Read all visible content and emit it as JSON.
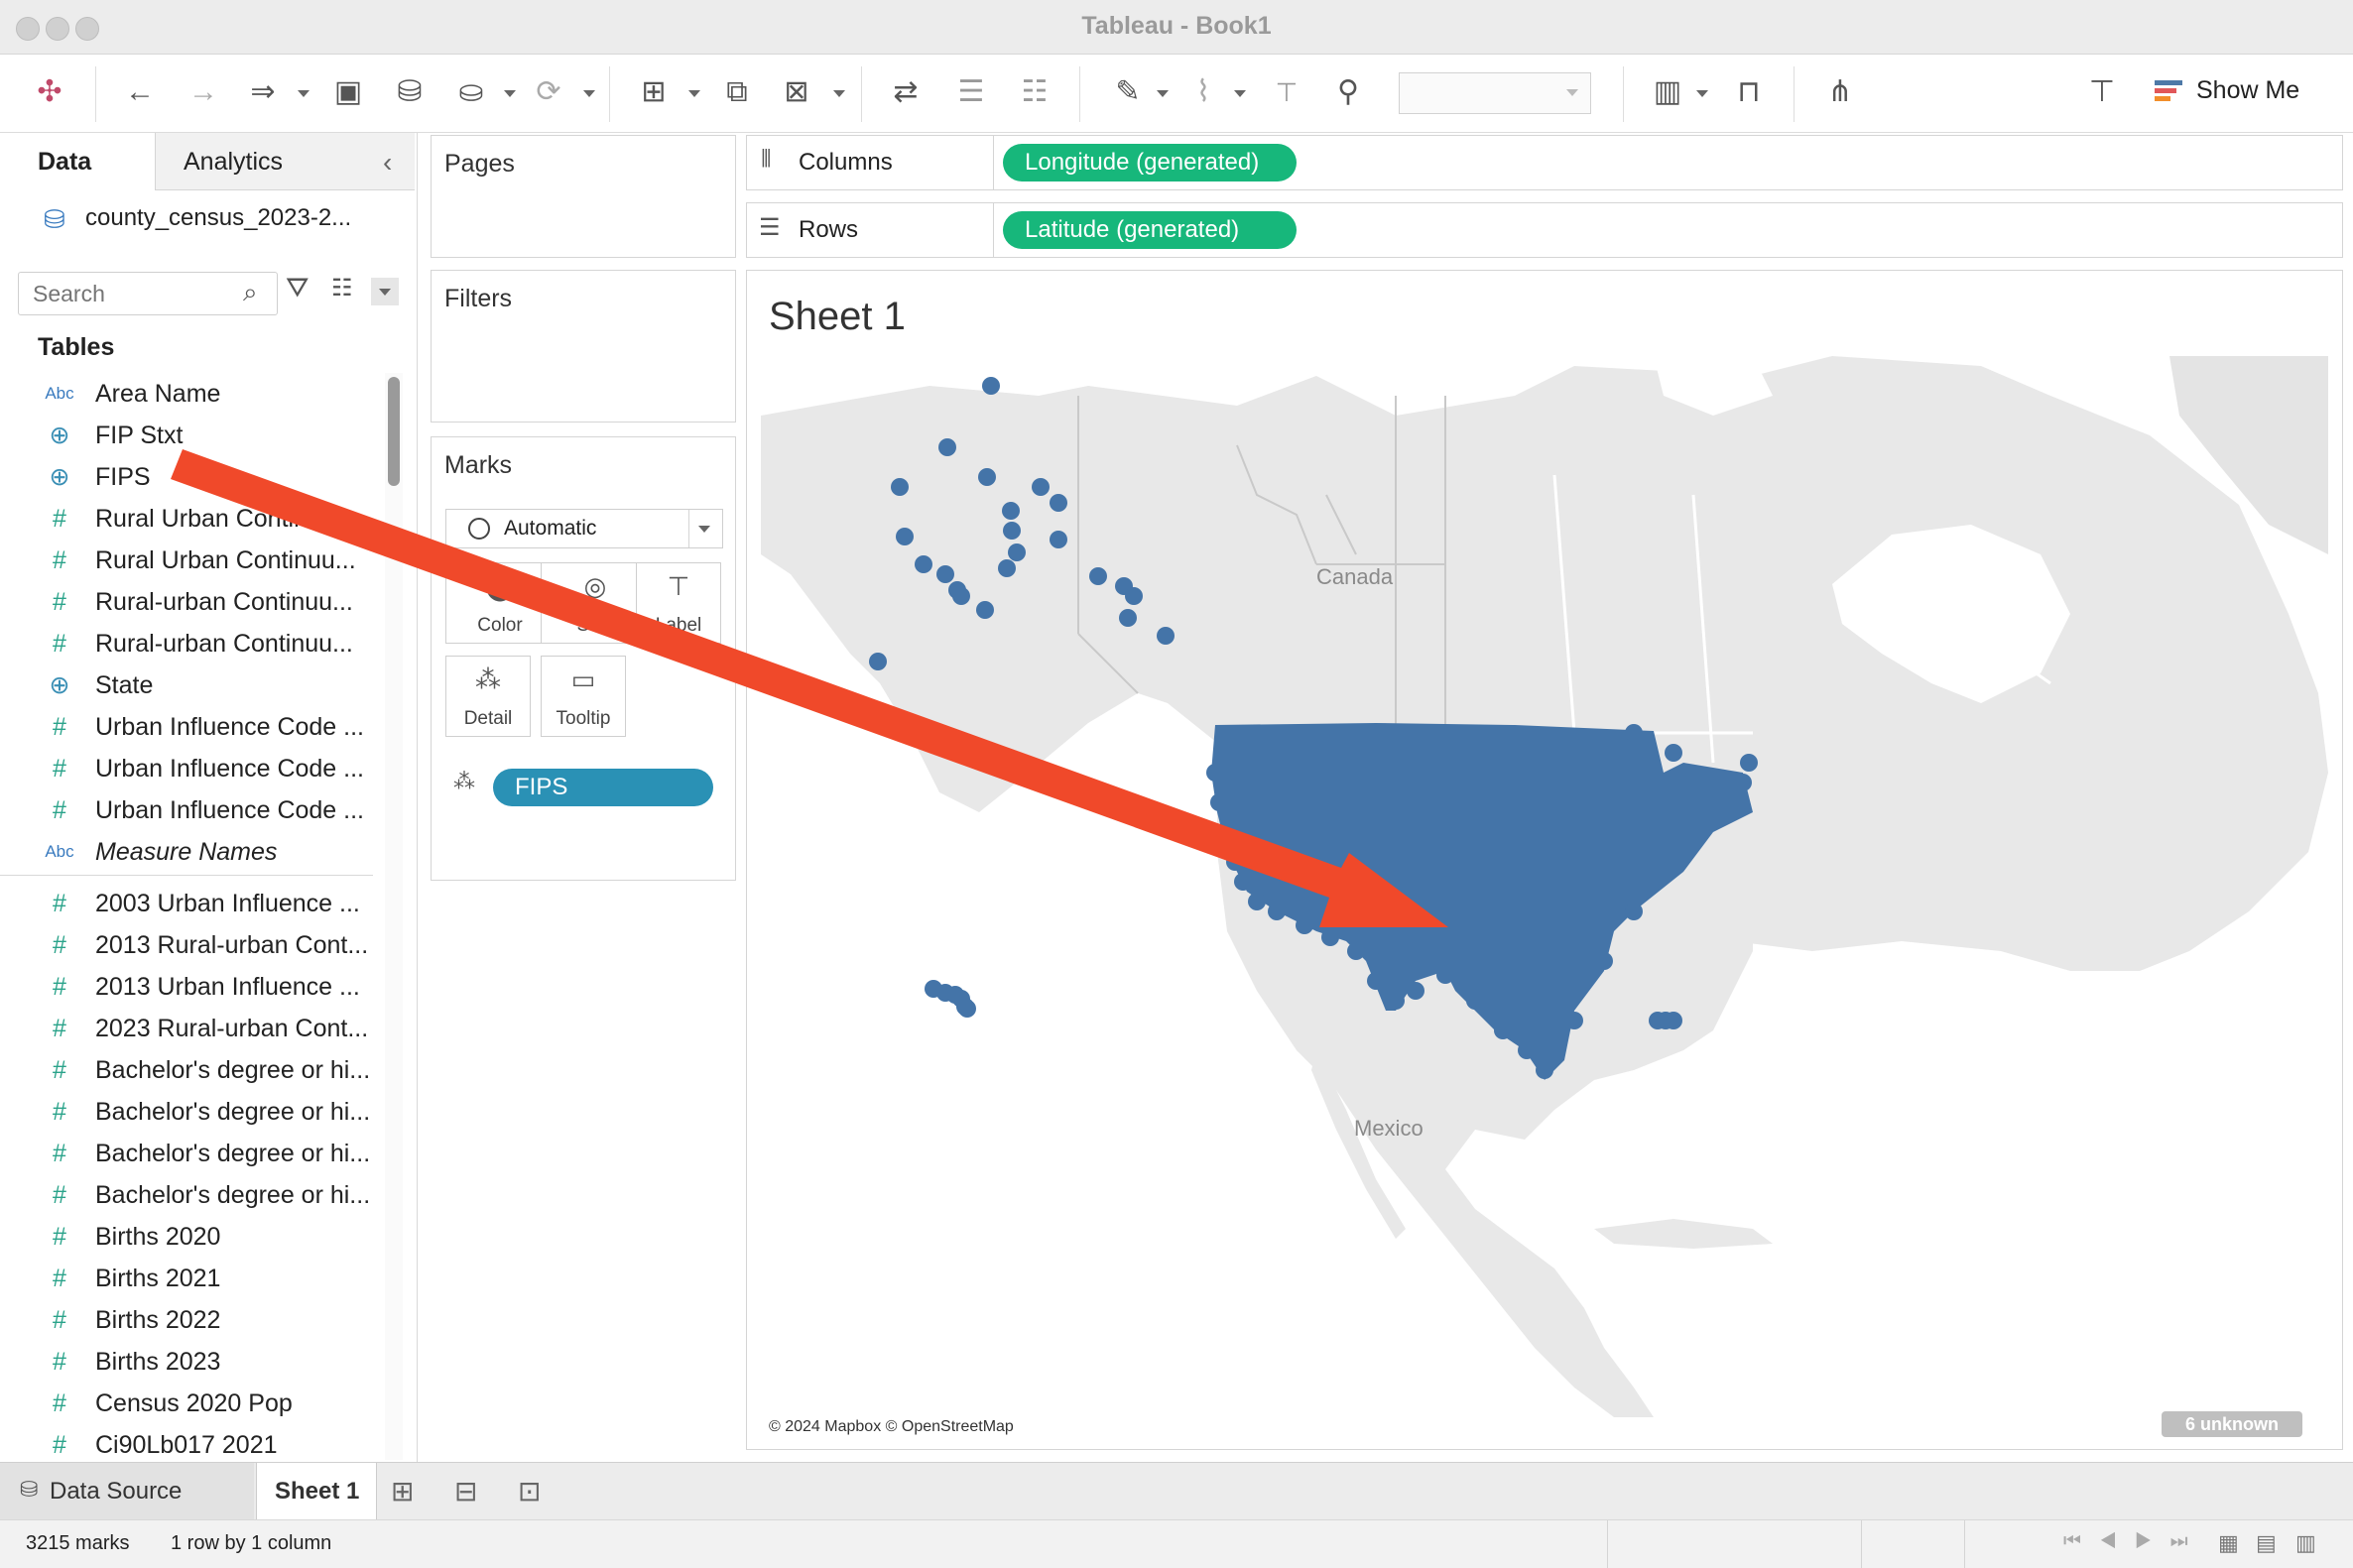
{
  "window": {
    "title": "Tableau - Book1"
  },
  "left_pane": {
    "tabs": [
      "Data",
      "Analytics"
    ],
    "datasource": "county_census_2023-2...",
    "search_placeholder": "Search",
    "tables_heading": "Tables",
    "fields": [
      {
        "type": "abc",
        "name": "Area Name"
      },
      {
        "type": "geo",
        "name": "FIP Stxt"
      },
      {
        "type": "geo",
        "name": "FIPS"
      },
      {
        "type": "num",
        "name": "Rural Urban Continuu..."
      },
      {
        "type": "num",
        "name": "Rural Urban Continuu..."
      },
      {
        "type": "num",
        "name": "Rural-urban Continuu..."
      },
      {
        "type": "num",
        "name": "Rural-urban Continuu..."
      },
      {
        "type": "geo",
        "name": "State"
      },
      {
        "type": "num",
        "name": "Urban Influence Code ..."
      },
      {
        "type": "num",
        "name": "Urban Influence Code ..."
      },
      {
        "type": "num",
        "name": "Urban Influence Code ..."
      },
      {
        "type": "abc",
        "name": "Measure Names"
      },
      {
        "type": "num",
        "name": "2003 Urban Influence ..."
      },
      {
        "type": "num",
        "name": "2013 Rural-urban Cont..."
      },
      {
        "type": "num",
        "name": "2013 Urban Influence ..."
      },
      {
        "type": "num",
        "name": "2023 Rural-urban Cont..."
      },
      {
        "type": "num",
        "name": "Bachelor's degree or hi..."
      },
      {
        "type": "num",
        "name": "Bachelor's degree or hi..."
      },
      {
        "type": "num",
        "name": "Bachelor's degree or hi..."
      },
      {
        "type": "num",
        "name": "Bachelor's degree or hi..."
      },
      {
        "type": "num",
        "name": "Births 2020"
      },
      {
        "type": "num",
        "name": "Births 2021"
      },
      {
        "type": "num",
        "name": "Births 2022"
      },
      {
        "type": "num",
        "name": "Births 2023"
      },
      {
        "type": "num",
        "name": "Census 2020 Pop"
      },
      {
        "type": "num",
        "name": "Ci90Lb017 2021"
      }
    ]
  },
  "toolbar": {
    "show_me": "Show Me"
  },
  "cards": {
    "pages": "Pages",
    "filters": "Filters",
    "marks": "Marks",
    "mark_type": "Automatic",
    "mark_buttons": [
      "Color",
      "Size",
      "Label",
      "Detail",
      "Tooltip"
    ],
    "detail_pill": "FIPS"
  },
  "shelves": {
    "columns_label": "Columns",
    "columns_pill": "Longitude (generated)",
    "rows_label": "Rows",
    "rows_pill": "Latitude (generated)"
  },
  "view": {
    "sheet_title": "Sheet 1",
    "labels": {
      "canada": "Canada",
      "mexico": "Mexico"
    },
    "attribution": "© 2024 Mapbox © OpenStreetMap",
    "unknown_badge": "6 unknown",
    "mark_color": "#4474a8",
    "annotation_arrow_color": "#f0492a"
  },
  "bottom": {
    "data_source_tab": "Data Source",
    "sheet_tab": "Sheet 1",
    "status_marks": "3215 marks",
    "status_dims": "1 row by 1 column"
  }
}
